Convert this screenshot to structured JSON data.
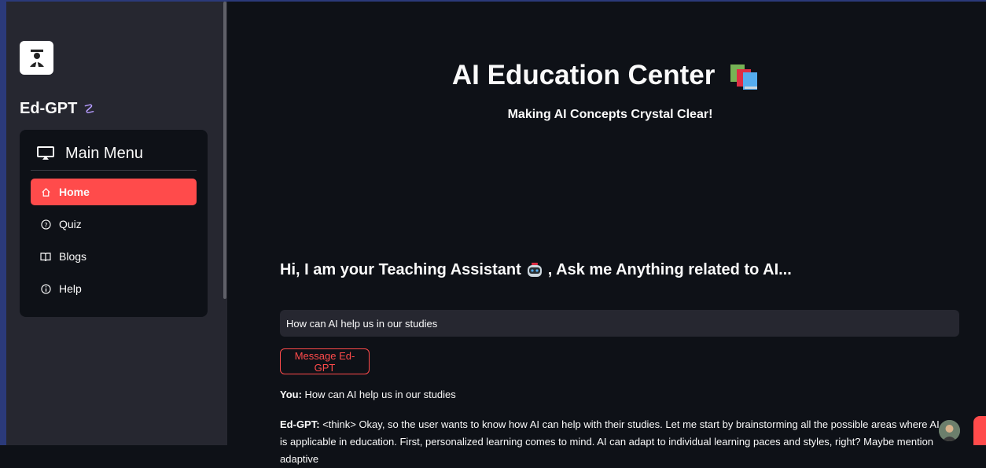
{
  "sidebar": {
    "brand": "Ed-GPT",
    "menu_title": "Main Menu",
    "items": [
      {
        "label": "Home",
        "icon": "home-icon",
        "active": true
      },
      {
        "label": "Quiz",
        "icon": "question-circle-icon",
        "active": false
      },
      {
        "label": "Blogs",
        "icon": "book-icon",
        "active": false
      },
      {
        "label": "Help",
        "icon": "info-circle-icon",
        "active": false
      }
    ]
  },
  "main": {
    "title": "AI Education Center",
    "subtitle": "Making AI Concepts Crystal Clear!",
    "assistant_heading_pre": "Hi, I am your Teaching Assistant",
    "assistant_heading_post": ", Ask me Anything related to AI...",
    "input_value": "How can AI help us in our studies",
    "send_label": "Message Ed-GPT",
    "user_prefix": "You:",
    "user_message": "How can AI help us in our studies",
    "bot_prefix": "Ed-GPT:",
    "bot_message": "<think> Okay, so the user wants to know how AI can help with their studies. Let me start by brainstorming all the possible areas where AI is applicable in education. First, personalized learning comes to mind. AI can adapt to individual learning paces and styles, right? Maybe mention adaptive"
  },
  "colors": {
    "accent": "#ff4b4b",
    "background": "#0e1117",
    "sidebar": "#262730"
  }
}
